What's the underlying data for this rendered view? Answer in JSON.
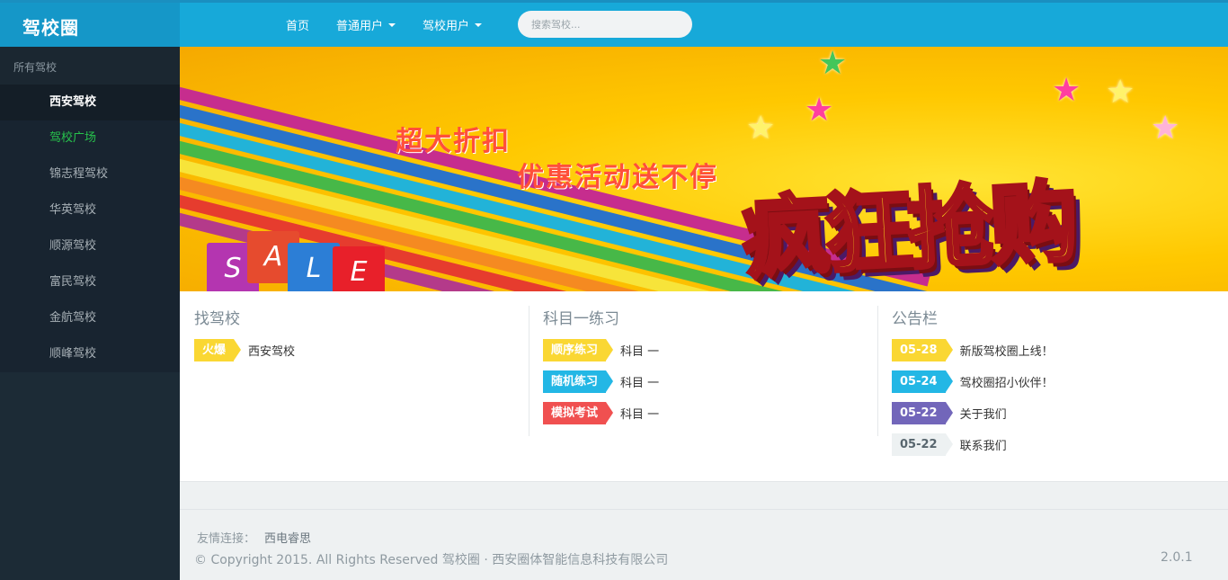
{
  "brand": "驾校圈",
  "nav": {
    "home": "首页",
    "regular_users": "普通用户",
    "school_users": "驾校用户",
    "search_placeholder": "搜索驾校..."
  },
  "sidebar": {
    "header": "所有驾校",
    "items": [
      {
        "label": "西安驾校"
      },
      {
        "label": "驾校广场"
      },
      {
        "label": "锦志程驾校"
      },
      {
        "label": "华英驾校"
      },
      {
        "label": "顺源驾校"
      },
      {
        "label": "富民驾校"
      },
      {
        "label": "金航驾校"
      },
      {
        "label": "顺峰驾校"
      }
    ]
  },
  "banner": {
    "line1": "超大折扣",
    "line2": "优惠活动送不停",
    "headline": "疯狂抢购",
    "bag_letters": [
      "S",
      "A",
      "L",
      "E"
    ],
    "active_slide": 3,
    "slide_count": 4
  },
  "panels": {
    "find_school": {
      "title": "找驾校",
      "items": [
        {
          "tag": "火爆",
          "text": "西安驾校",
          "color": "#fad733"
        }
      ]
    },
    "practice": {
      "title": "科目一练习",
      "items": [
        {
          "tag": "顺序练习",
          "text": "科目 一",
          "color": "#fad733"
        },
        {
          "tag": "随机练习",
          "text": "科目 一",
          "color": "#23b7e5"
        },
        {
          "tag": "模拟考试",
          "text": "科目 一",
          "color": "#f05050"
        }
      ]
    },
    "notice": {
      "title": "公告栏",
      "items": [
        {
          "tag": "05-28",
          "text": "新版驾校圈上线！",
          "color": "#fad733"
        },
        {
          "tag": "05-24",
          "text": "驾校圈招小伙伴！",
          "color": "#23b7e5"
        },
        {
          "tag": "05-22",
          "text": "关于我们",
          "color": "#7266ba"
        },
        {
          "tag": "05-22",
          "text": "联系我们",
          "color": "#edf1f2"
        }
      ]
    }
  },
  "footer": {
    "friend_label": "友情连接：",
    "friend_link": "西电睿思",
    "copyright": "© Copyright 2015. All Rights Reserved 驾校圈 · 西安圈体智能信息科技有限公司",
    "version": "2.0.1"
  }
}
